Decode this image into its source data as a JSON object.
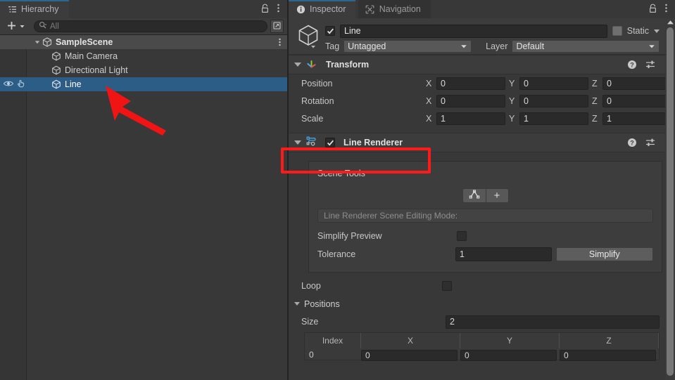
{
  "hierarchy": {
    "tab_label": "Hierarchy",
    "tab_icon": "hierarchy-list-icon",
    "lock_icon": "lock-icon",
    "menu_icon": "kebab-menu-icon",
    "toolbar": {
      "add_label": "+",
      "add_dropdown_icon": "chevron-down-icon",
      "search_icon": "search-icon",
      "search_placeholder": "All",
      "search_value": "",
      "expand_button_icon": "open-external-icon"
    },
    "items": [
      {
        "label": "SampleScene",
        "icon": "scene-icon",
        "depth": 0,
        "selected": false,
        "is_scene": true,
        "expanded": true,
        "menu_icon": "kebab-menu-icon"
      },
      {
        "label": "Main Camera",
        "icon": "gameobject-cube-icon",
        "depth": 1,
        "selected": false,
        "is_scene": false
      },
      {
        "label": "Directional Light",
        "icon": "gameobject-cube-icon",
        "depth": 1,
        "selected": false,
        "is_scene": false
      },
      {
        "label": "Line",
        "icon": "gameobject-cube-icon",
        "depth": 1,
        "selected": true,
        "is_scene": false,
        "visibility_icon": "eye-icon",
        "pickability_icon": "hand-pointer-icon"
      }
    ]
  },
  "inspector": {
    "tabs": [
      {
        "label": "Inspector",
        "icon": "info-circle-icon",
        "active": true
      },
      {
        "label": "Navigation",
        "icon": "navigation-mesh-icon",
        "active": false
      }
    ],
    "lock_icon": "lock-icon",
    "menu_icon": "kebab-menu-icon",
    "object_header": {
      "prefab_icon": "gameobject-cube-icon",
      "enabled": true,
      "name_value": "Line",
      "static_checked": false,
      "static_label": "Static",
      "static_dropdown_icon": "chevron-down-icon",
      "tag_label": "Tag",
      "tag_value": "Untagged",
      "layer_label": "Layer",
      "layer_value": "Default",
      "dropdown_icon": "chevron-down-icon"
    },
    "transform": {
      "title": "Transform",
      "icon": "transform-axis-icon",
      "expanded": true,
      "help_icon": "help-circle-icon",
      "preset_icon": "preset-sliders-icon",
      "menu_icon": "kebab-menu-icon",
      "rows": [
        {
          "label": "Position",
          "x": "0",
          "y": "0",
          "z": "0"
        },
        {
          "label": "Rotation",
          "x": "0",
          "y": "0",
          "z": "0"
        },
        {
          "label": "Scale",
          "x": "1",
          "y": "1",
          "z": "1"
        }
      ],
      "axis_labels": [
        "X",
        "Y",
        "Z"
      ]
    },
    "line_renderer": {
      "title": "Line Renderer",
      "icon": "line-renderer-icon",
      "enabled": true,
      "expanded": true,
      "help_icon": "help-circle-icon",
      "preset_icon": "preset-sliders-icon",
      "menu_icon": "kebab-menu-icon",
      "highlighted": true,
      "scene_tools": {
        "title": "Scene Tools",
        "edit_points_icon": "edit-polyline-icon",
        "create_points_label": "+",
        "mode_text": "Line Renderer Scene Editing Mode:",
        "simplify_preview_label": "Simplify Preview",
        "simplify_preview_checked": false,
        "tolerance_label": "Tolerance",
        "tolerance_value": "1",
        "simplify_button_label": "Simplify"
      },
      "loop_label": "Loop",
      "loop_checked": false,
      "positions_label": "Positions",
      "positions_expanded": true,
      "size_label": "Size",
      "size_value": "2",
      "table": {
        "headers": [
          "Index",
          "X",
          "Y",
          "Z"
        ],
        "rows": [
          {
            "index": "0",
            "x": "0",
            "y": "0",
            "z": "0"
          }
        ]
      }
    },
    "scrollbar": {
      "up_arrow_icon": "scroll-up-arrow-icon"
    }
  },
  "annotation": {
    "arrow_color": "#f01414",
    "highlight_color": "#ff1a1a",
    "arrow_name": "red-pointer-arrow",
    "highlight_name": "red-highlight-box"
  },
  "colors": {
    "panel_bg": "#383838",
    "header_bg": "#3c3c3c",
    "selection_blue": "#2c5d87",
    "tab_accent": "#2c6794",
    "field_bg": "#2a2a2a"
  }
}
